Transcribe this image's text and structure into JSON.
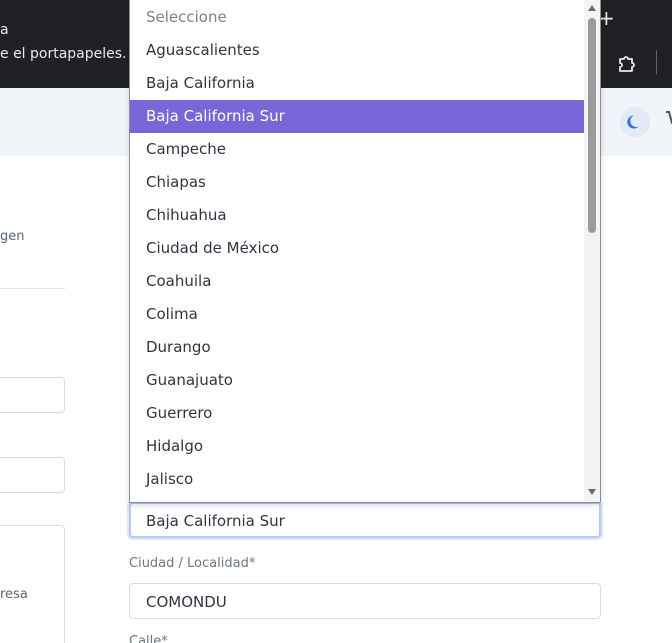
{
  "browser": {
    "toast_line1": "a",
    "toast_line2": "e el portapapeles.",
    "new_tab_glyph": "+",
    "extensions_icon": "puzzle-icon"
  },
  "header": {
    "theme_icon": "moon-icon",
    "cart_icon": "cart-icon"
  },
  "left_column": {
    "label_imagen": "gen",
    "label_empresa": "resa"
  },
  "form": {
    "state_value": "Baja California Sur",
    "city_label": "Ciudad / Localidad*",
    "city_value": "COMONDU",
    "street_label": "Calle*"
  },
  "dropdown": {
    "placeholder": "Seleccione",
    "options": [
      "Aguascalientes",
      "Baja California",
      "Baja California Sur",
      "Campeche",
      "Chiapas",
      "Chihuahua",
      "Ciudad de México",
      "Coahuila",
      "Colima",
      "Durango",
      "Guanajuato",
      "Guerrero",
      "Hidalgo",
      "Jalisco"
    ],
    "selected": "Baja California Sur"
  },
  "colors": {
    "selected_bg": "#7767d8",
    "chrome_bg": "#202124",
    "focus_ring": "#b9c9f2"
  }
}
